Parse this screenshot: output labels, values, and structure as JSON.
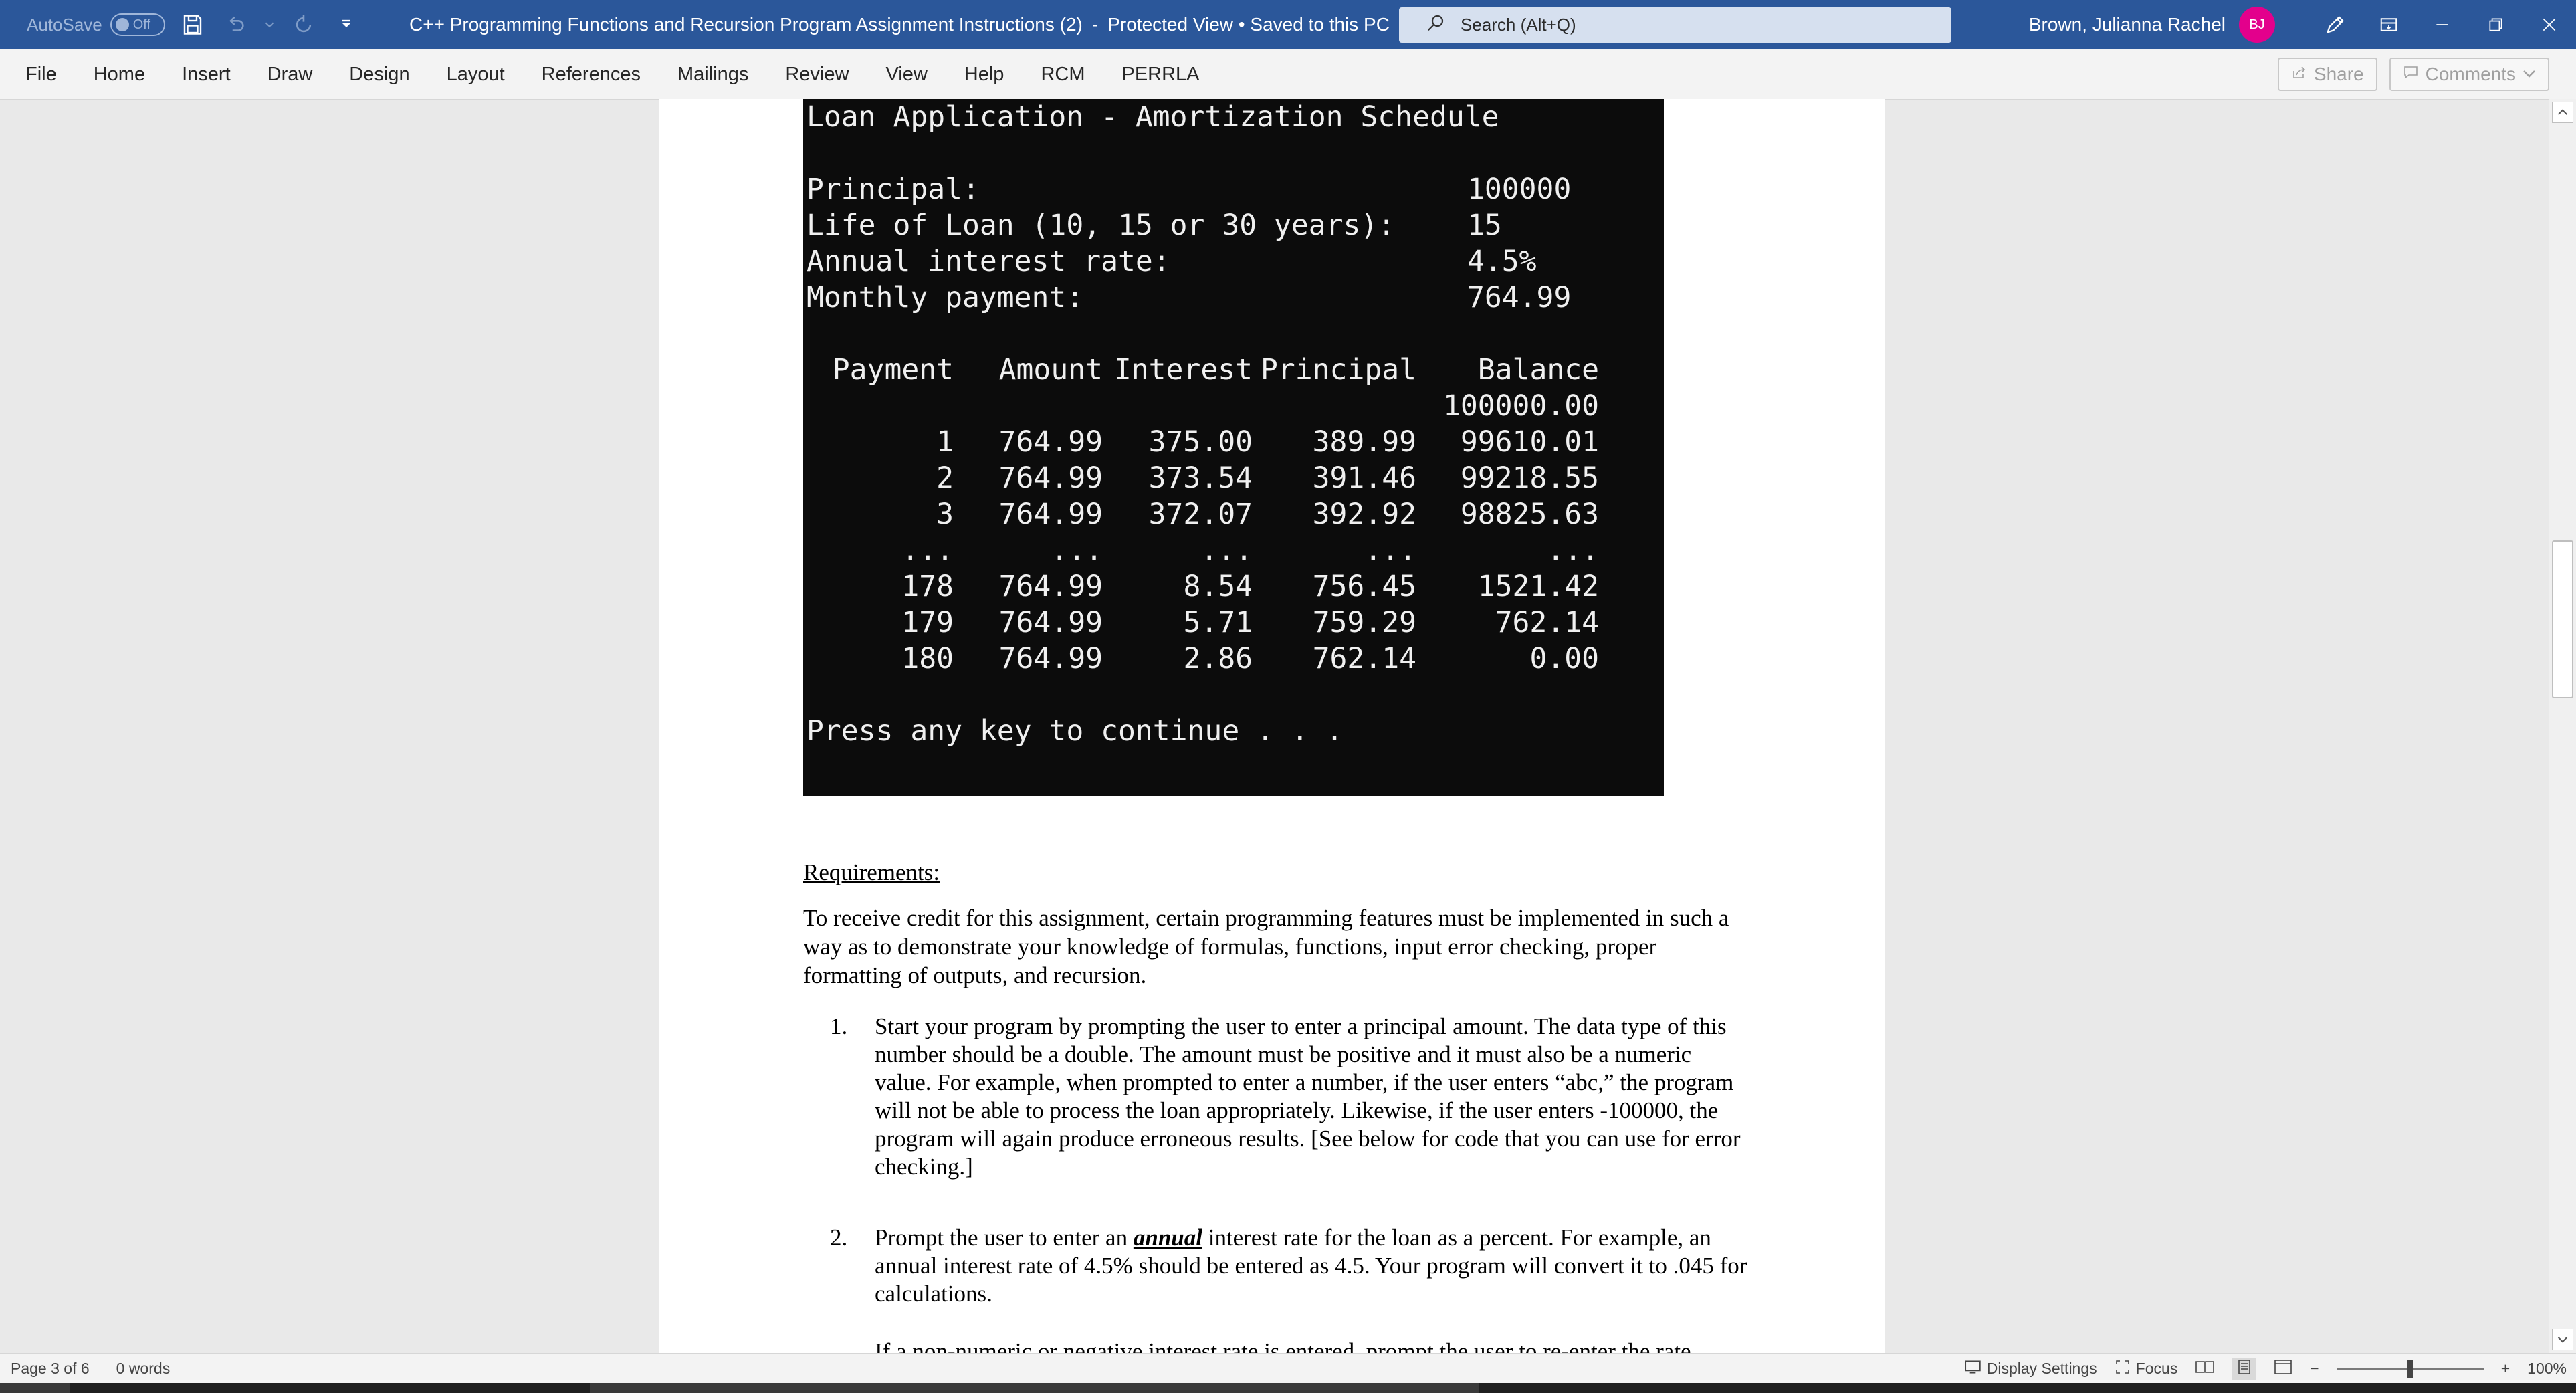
{
  "titlebar": {
    "autosave_label": "AutoSave",
    "autosave_state": "Off",
    "doc_title": "C++ Programming Functions and Recursion Program Assignment Instructions (2)",
    "separator": "-",
    "status": "Protected View • Saved to this PC",
    "search_placeholder": "Search (Alt+Q)",
    "user_name": "Brown, Julianna Rachel",
    "user_initials": "BJ",
    "colors": {
      "bar": "#2b579a",
      "avatar": "#e3008c"
    }
  },
  "ribbon": {
    "tabs": [
      "File",
      "Home",
      "Insert",
      "Draw",
      "Design",
      "Layout",
      "References",
      "Mailings",
      "Review",
      "View",
      "Help",
      "RCM",
      "PERRLA"
    ],
    "share_label": "Share",
    "comments_label": "Comments"
  },
  "console": {
    "title": "Loan Application - Amortization Schedule",
    "fields": [
      {
        "label": "Principal:",
        "value": "100000"
      },
      {
        "label": "Life of Loan (10, 15 or 30 years):",
        "value": "15"
      },
      {
        "label": "Annual interest rate:",
        "value": "4.5%"
      },
      {
        "label": "Monthly payment:",
        "value": "764.99"
      }
    ],
    "headers": [
      "Payment",
      "Amount",
      "Interest",
      "Principal",
      "Balance"
    ],
    "initial_balance": "100000.00",
    "rows": [
      [
        "1",
        "764.99",
        "375.00",
        "389.99",
        "99610.01"
      ],
      [
        "2",
        "764.99",
        "373.54",
        "391.46",
        "99218.55"
      ],
      [
        "3",
        "764.99",
        "372.07",
        "392.92",
        "98825.63"
      ],
      [
        "...",
        "...",
        "...",
        "...",
        "..."
      ],
      [
        "178",
        "764.99",
        "8.54",
        "756.45",
        "1521.42"
      ],
      [
        "179",
        "764.99",
        "5.71",
        "759.29",
        "762.14"
      ],
      [
        "180",
        "764.99",
        "2.86",
        "762.14",
        "0.00"
      ]
    ],
    "footer": "Press any key to continue . . ."
  },
  "document": {
    "req_heading": "Requirements:",
    "intro": "To receive credit for this assignment, certain programming features must be implemented in such a way as to demonstrate your knowledge of formulas, functions, input error checking, proper formatting of outputs, and recursion.",
    "item1_num": "1.",
    "item1_text": "Start your program by prompting the user to enter a principal amount.  The data type of this number should be a double.  The amount must be positive and it must also be a numeric value.  For example, when prompted to enter a number, if the user enters “abc,” the program will not be able to process the loan appropriately. Likewise, if the user enters -100000, the program will again produce erroneous results.  [See below for code that you can use for error checking.]",
    "item2_num": "2.",
    "item2_pre": "Prompt the user to enter an ",
    "item2_em": "annual",
    "item2_post": " interest rate for the loan as a percent.  For example, an annual interest rate of 4.5% should be entered as 4.5.  Your program will convert it to .045 for calculations.",
    "cut_line": "If a non-numeric or negative interest rate is entered, prompt the user to re-enter the rate."
  },
  "statusbar": {
    "page": "Page 3 of 6",
    "words": "0 words",
    "display_settings": "Display Settings",
    "focus": "Focus",
    "zoom": "100%",
    "zoom_fraction": 0.5
  }
}
